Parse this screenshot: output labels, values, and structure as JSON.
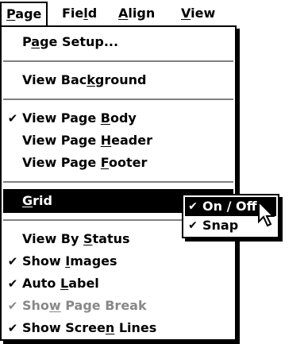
{
  "menubar": {
    "items": [
      {
        "label": "Page",
        "accel_before": "",
        "accel": "P",
        "accel_after": "age"
      },
      {
        "label": "Field",
        "accel_before": "Fie",
        "accel": "l",
        "accel_after": "d"
      },
      {
        "label": "Align",
        "accel_before": "",
        "accel": "A",
        "accel_after": "lign"
      },
      {
        "label": "View",
        "accel_before": "",
        "accel": "V",
        "accel_after": "iew"
      }
    ]
  },
  "menu": {
    "page_setup": {
      "before": "P",
      "accel": "a",
      "after": "ge Setup...",
      "checked": false
    },
    "view_background": {
      "before": "View Bac",
      "accel": "k",
      "after": "ground",
      "checked": false
    },
    "view_page_body": {
      "before": "View Page ",
      "accel": "B",
      "after": "ody",
      "checked": true
    },
    "view_page_header": {
      "before": "View Page ",
      "accel": "H",
      "after": "eader",
      "checked": false
    },
    "view_page_footer": {
      "before": "View Page ",
      "accel": "F",
      "after": "ooter",
      "checked": false
    },
    "grid": {
      "before": "",
      "accel": "G",
      "after": "rid",
      "checked": false,
      "submenu_arrow": "▶"
    },
    "view_by_status": {
      "before": "View By ",
      "accel": "S",
      "after": "tatus",
      "checked": false
    },
    "show_images": {
      "before": "Show ",
      "accel": "I",
      "after": "mages",
      "checked": true
    },
    "auto_label": {
      "before": "Auto ",
      "accel": "L",
      "after": "abel",
      "checked": true
    },
    "show_page_break": {
      "before": "Sho",
      "accel": "w",
      "after": " Page Break",
      "checked": true,
      "disabled": true
    },
    "show_screen_lines": {
      "before": "Show Scree",
      "accel": "n",
      "after": " Lines",
      "checked": true
    }
  },
  "submenu": {
    "on_off": {
      "label": "On / Off",
      "checked": true
    },
    "snap": {
      "label": "Snap",
      "checked": true
    }
  },
  "check_glyph": "✔",
  "cursor_icon": "arrow-pointer"
}
